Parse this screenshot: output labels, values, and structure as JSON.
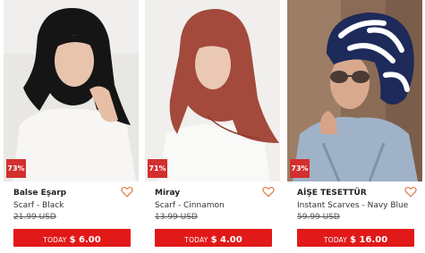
{
  "products": [
    {
      "brand": "Balse Eşarp",
      "name": "Scarf - Black",
      "old_price": "21.99 USD",
      "discount": "73%",
      "today_label": "TODAY",
      "today_price": "$ 6.00",
      "image_desc": "woman-black-scarf"
    },
    {
      "brand": "Miray",
      "name": "Scarf - Cinnamon",
      "old_price": "13.99 USD",
      "discount": "71%",
      "today_label": "TODAY",
      "today_price": "$ 4.00",
      "image_desc": "woman-cinnamon-scarf"
    },
    {
      "brand": "AİŞE TESETTÜR",
      "name": "Instant Scarves - Navy Blue",
      "old_price": "59.99 USD",
      "discount": "73%",
      "today_label": "TODAY",
      "today_price": "$ 16.00",
      "image_desc": "woman-navy-instant-scarf"
    }
  ],
  "colors": {
    "badge": "#d32f2f",
    "buy_button": "#e11919",
    "heart": "#e0763f"
  },
  "icons": {
    "favorite": "heart-outline-icon"
  }
}
